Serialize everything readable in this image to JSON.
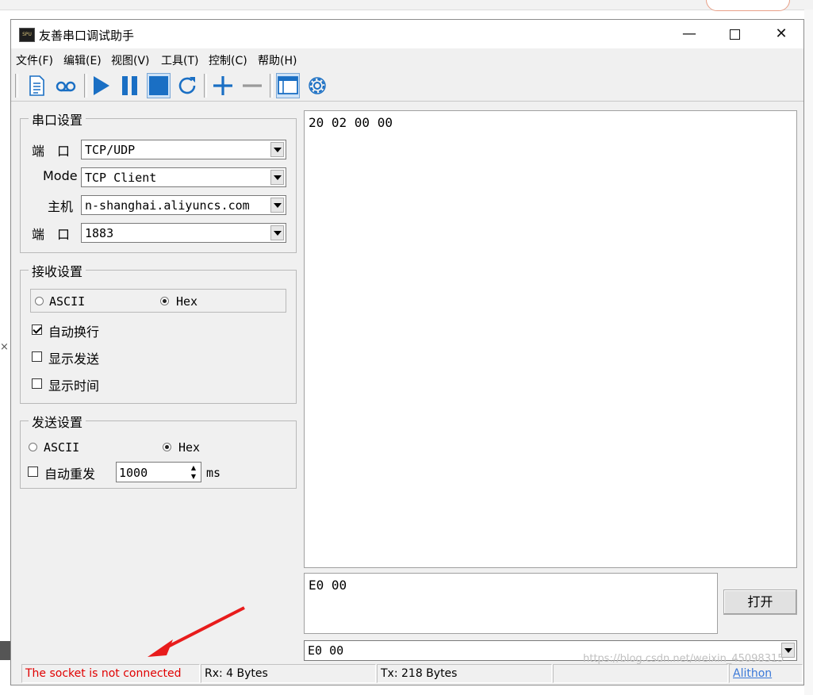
{
  "window": {
    "title": "友善串口调试助手"
  },
  "menu": [
    "文件(F)",
    "编辑(E)",
    "视图(V)",
    "工具(T)",
    "控制(C)",
    "帮助(H)"
  ],
  "toolbar": {
    "icons": [
      "new-file-icon",
      "record-icon",
      "play-icon",
      "pause-icon",
      "stop-icon",
      "refresh-icon",
      "add-icon",
      "remove-icon",
      "window-icon",
      "settings-icon"
    ],
    "accent_color": "#1a6fc4"
  },
  "serial_settings": {
    "title": "串口设置",
    "port_label": "端　口",
    "port_value": "TCP/UDP",
    "mode_label": "Mode",
    "mode_value": "TCP Client",
    "host_label": "主机",
    "host_value": "n-shanghai.aliyuncs.com",
    "port2_label": "端　口",
    "port2_value": "1883"
  },
  "receive_settings": {
    "title": "接收设置",
    "ascii_label": "ASCII",
    "hex_label": "Hex",
    "selected": "Hex",
    "auto_newline_label": "自动换行",
    "auto_newline_checked": true,
    "show_send_label": "显示发送",
    "show_send_checked": false,
    "show_time_label": "显示时间",
    "show_time_checked": false
  },
  "send_settings": {
    "title": "发送设置",
    "ascii_label": "ASCII",
    "hex_label": "Hex",
    "selected": "Hex",
    "auto_resend_label": "自动重发",
    "auto_resend_checked": false,
    "interval_value": "1000",
    "interval_unit": "ms"
  },
  "receive_area": {
    "content": "20 02 00 00"
  },
  "send_area": {
    "content": "E0 00"
  },
  "open_button": {
    "label": "打开"
  },
  "history_combo": {
    "value": "E0 00"
  },
  "status": {
    "message": "The socket is not connected",
    "message_color": "#e00000",
    "rx": "Rx: 4 Bytes",
    "tx": "Tx: 218 Bytes",
    "link": "Alithon"
  },
  "watermark": "https://blog.csdn.net/weixin_45098315"
}
